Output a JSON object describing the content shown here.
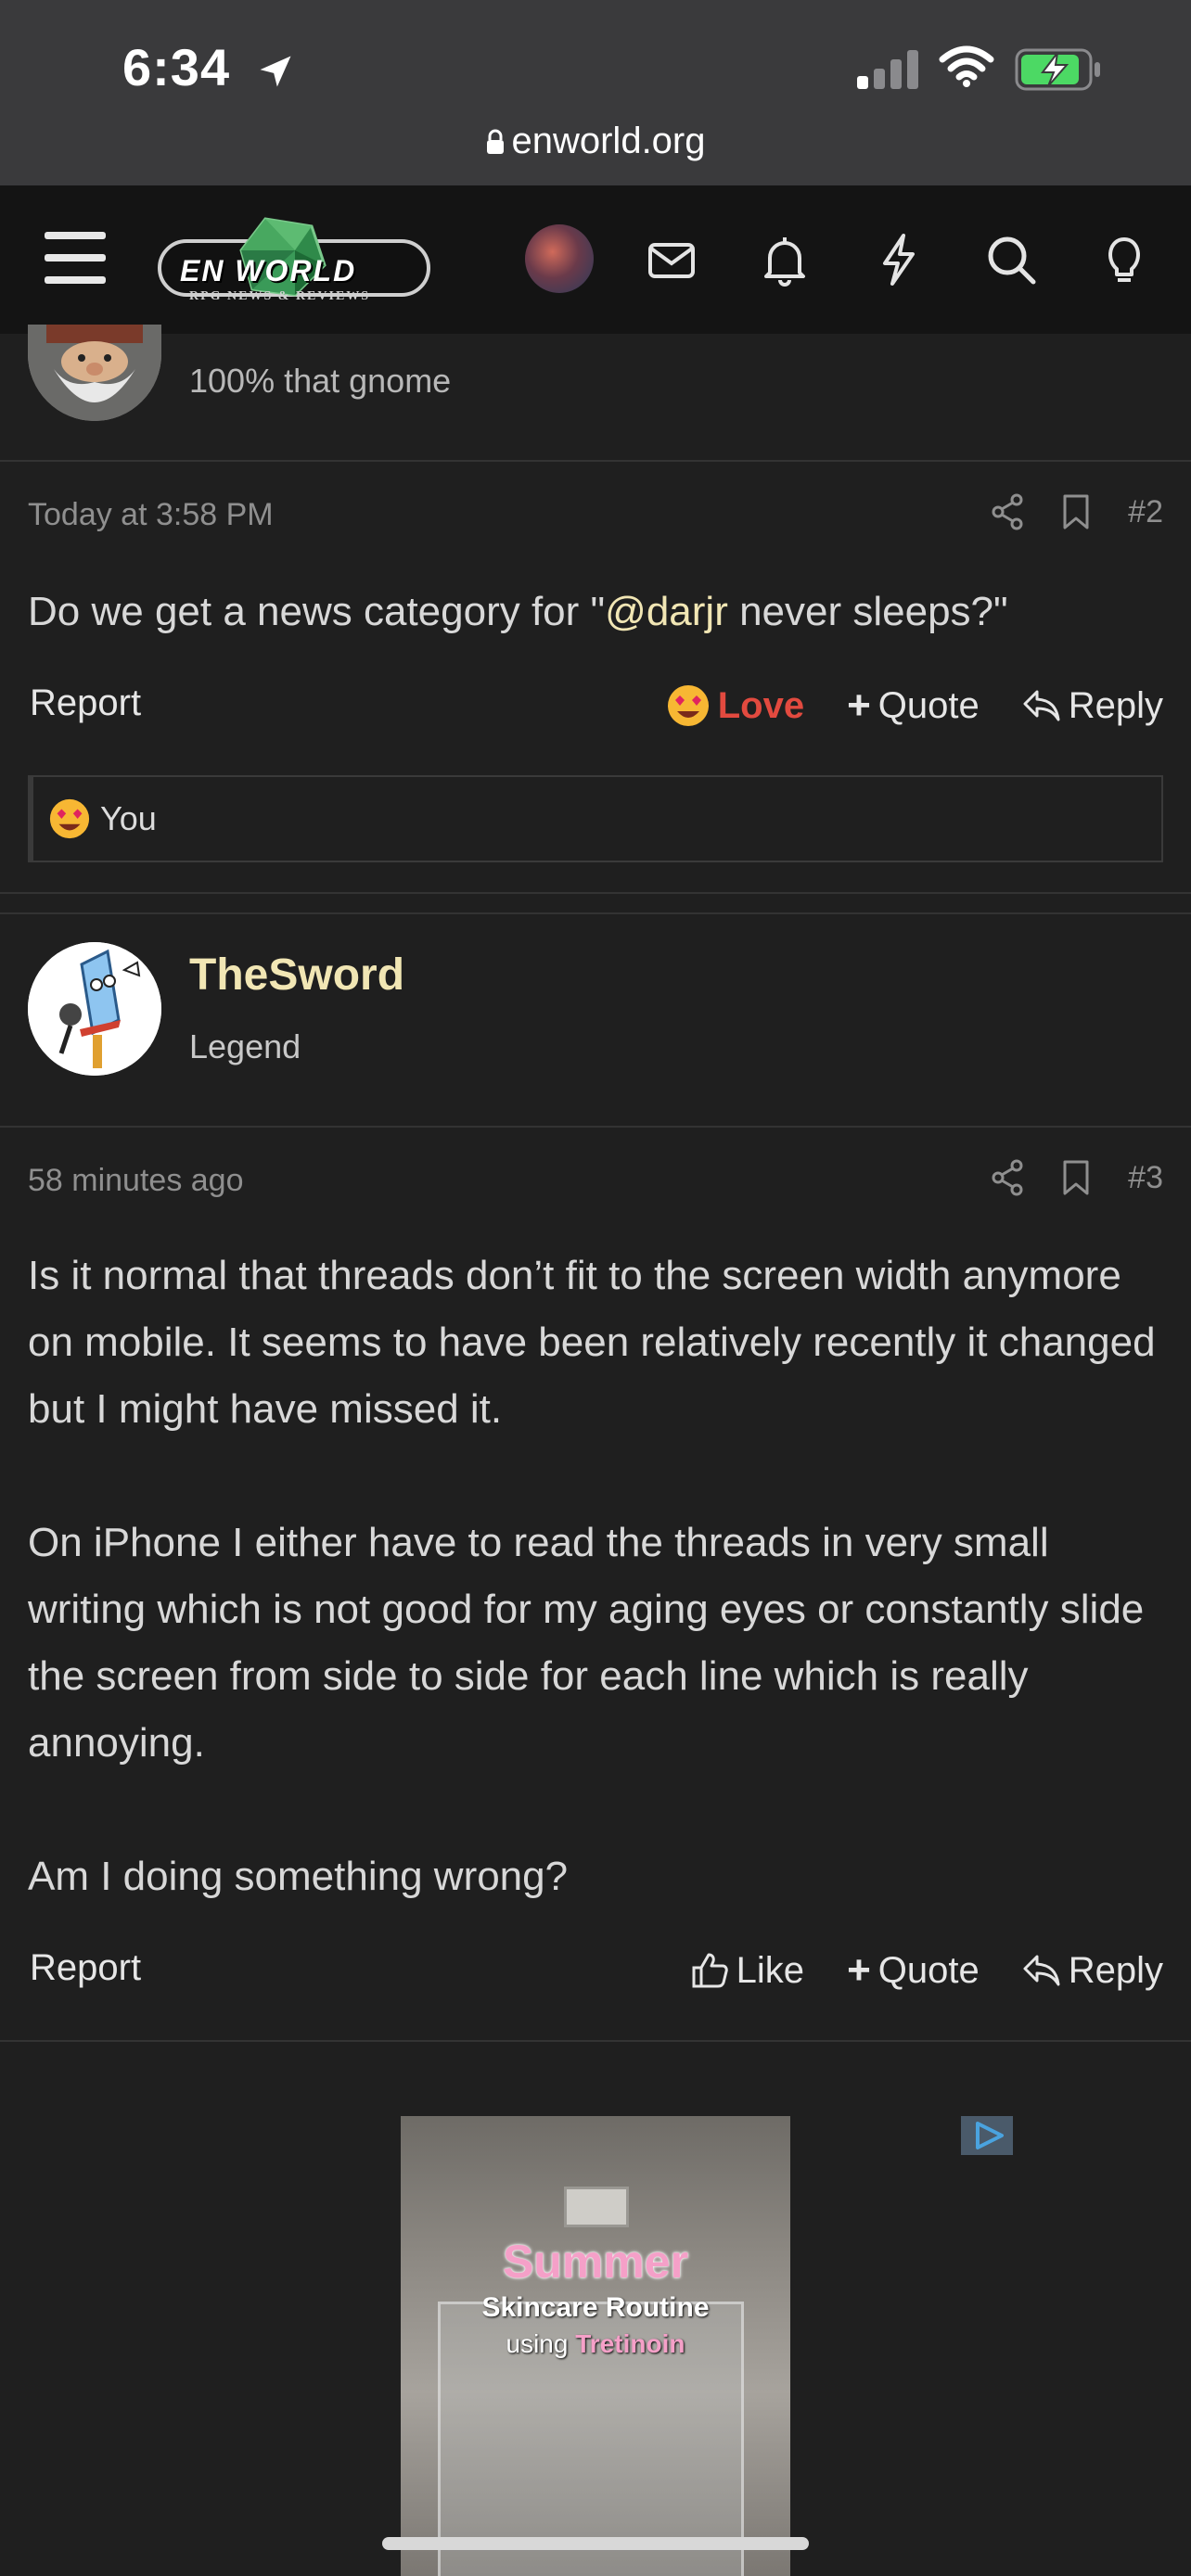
{
  "status_bar": {
    "time": "6:34",
    "url": "enworld.org"
  },
  "header": {
    "logo_text": "EN WORLD",
    "logo_tagline": "RPG NEWS & REVIEWS"
  },
  "post2": {
    "author_title": "100% that gnome",
    "timestamp": "Today at 3:58 PM",
    "number": "#2",
    "body_pre": "Do we get a news category for \"",
    "mention": "@darjr",
    "body_post": " never sleeps?\"",
    "report": "Report",
    "love": "Love",
    "quote": "Quote",
    "reply": "Reply",
    "reaction_user": "You"
  },
  "post3": {
    "author_name": "TheSword",
    "author_title": "Legend",
    "timestamp": "58 minutes ago",
    "number": "#3",
    "paragraphs": [
      "Is it normal that threads don’t fit to the screen width anymore on mobile. It seems to have been relatively recently it changed but I might have missed it.",
      "On iPhone I either have to read the threads in very small writing which is not good for my aging eyes or constantly slide the screen from side to side for each line which is really annoying.",
      "Am I doing something wrong?"
    ],
    "report": "Report",
    "like": "Like",
    "quote": "Quote",
    "reply": "Reply"
  },
  "ad": {
    "title": "Summer",
    "line1": "Skincare Routine",
    "line2_pre": "using ",
    "line2_highlight": "Tretinoin"
  },
  "colors": {
    "background": "#1f1f1f",
    "username": "#f1e6b4",
    "love": "#e24a3f"
  },
  "icons": [
    "location-arrow-icon",
    "signal-icon",
    "wifi-icon",
    "battery-charging-icon",
    "lock-icon",
    "menu-icon",
    "mail-icon",
    "bell-icon",
    "bolt-icon",
    "search-icon",
    "lightbulb-icon",
    "share-icon",
    "bookmark-icon",
    "love-emoji-icon",
    "plus-icon",
    "reply-icon",
    "thumbs-up-icon",
    "adchoices-icon"
  ]
}
